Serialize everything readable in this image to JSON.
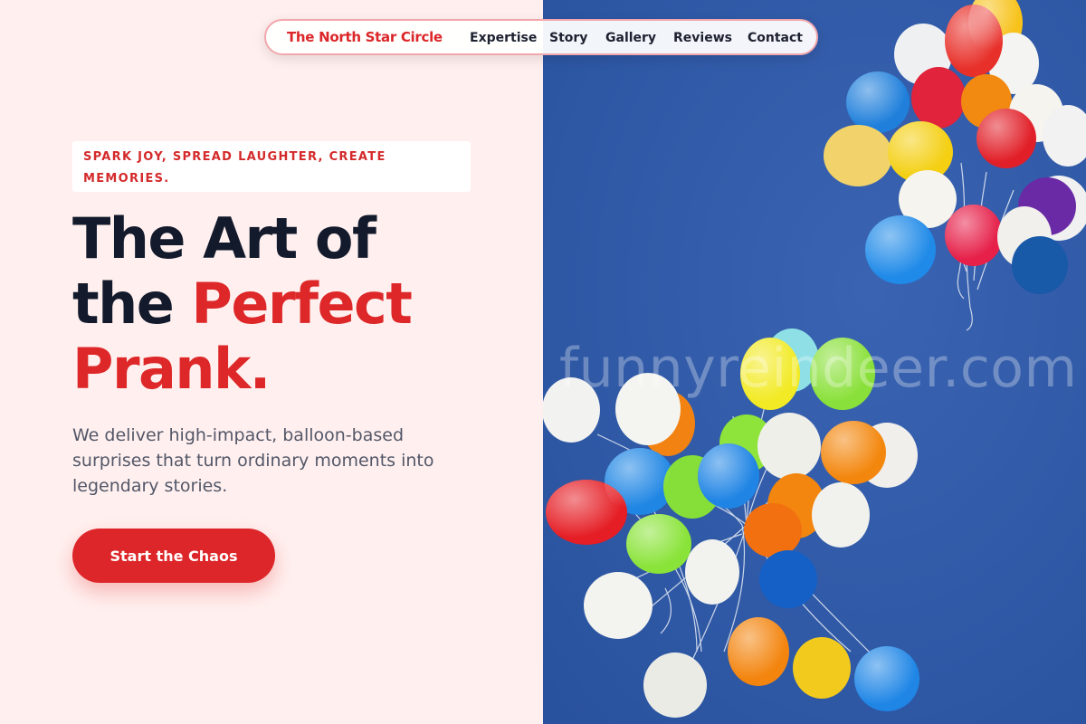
{
  "nav": {
    "brand": "The North Star Circle",
    "links": [
      "Expertise",
      "Story",
      "Gallery",
      "Reviews",
      "Contact"
    ]
  },
  "hero": {
    "tagline": "SPARK JOY, SPREAD LAUGHTER, CREATE MEMORIES.",
    "headline": {
      "line1": "The Art of",
      "line2_plain": "the ",
      "line2_accent": "Perfect",
      "line3_accent": "Prank."
    },
    "description": "We deliver high-impact, balloon-based surprises that turn ordinary moments into legendary stories.",
    "cta_label": "Start the Chaos"
  },
  "image": {
    "watermark": "funnyreindeer.com"
  },
  "colors": {
    "accent": "#dd2728",
    "left_background": "#fff0ef",
    "headline": "#131a2c",
    "sky": "#2f5aa6"
  }
}
